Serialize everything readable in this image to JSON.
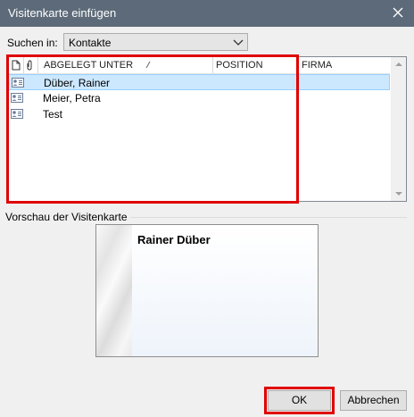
{
  "window": {
    "title": "Visitenkarte einfügen"
  },
  "search": {
    "label": "Suchen in:",
    "value": "Kontakte"
  },
  "list": {
    "columns": {
      "filed_under": "ABGELEGT UNTER",
      "position": "POSITION",
      "company": "FIRMA"
    },
    "rows": [
      {
        "name": "Düber, Rainer",
        "selected": true
      },
      {
        "name": "Meier, Petra",
        "selected": false
      },
      {
        "name": "Test",
        "selected": false
      }
    ]
  },
  "preview": {
    "label": "Vorschau der Visitenkarte",
    "card_name": "Rainer Düber"
  },
  "buttons": {
    "ok": "OK",
    "cancel": "Abbrechen"
  },
  "colors": {
    "titlebar": "#5c6a79",
    "selection": "#cce8ff",
    "annotation": "#e00000"
  },
  "icons": {
    "close": "close-icon",
    "dropdown": "chevron-down-icon",
    "document": "document-icon",
    "attachment": "paperclip-icon",
    "contact": "contact-card-icon",
    "sort": "sort-indicator-icon"
  }
}
